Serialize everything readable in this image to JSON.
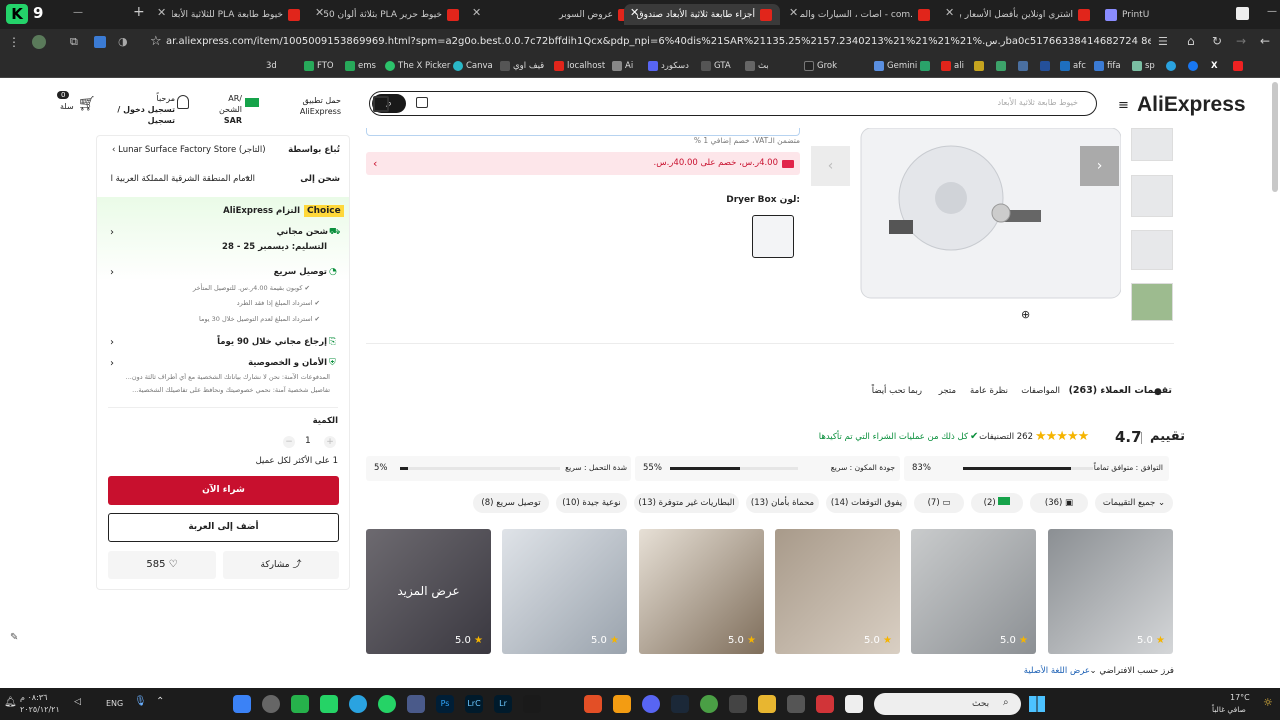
{
  "browser": {
    "tabs": [
      {
        "title": "PrintU"
      },
      {
        "title": "اشتري اونلاين بأفضل الأسعار بال..."
      },
      {
        "title": ".com - اصات ، السيارات والمزيد..."
      },
      {
        "title": "أجزاء طابعة ثلاثية الأبعاد صندوق"
      },
      {
        "title": "عروض السوبر"
      },
      {
        "title": "خيوط حرير PLA بثلاثة ألوان 250"
      },
      {
        "title": "خيوط طابعة PLA للثلاثية الأبعاد 5"
      }
    ],
    "url": "ar.aliexpress.com/item/1005009153869969.html?spm=a2g0o.best.0.0.7c72bffdih1Qcx&pdp_npi=6%40dis%21SAR%21135.25%2157.2340213%21%21%21%21%.ر.سba0c51766338414682724 8eb775%21120000481179654 45%21btfaff...",
    "bookmarks": [
      "sp",
      "fifa",
      "afc",
      "ali",
      "Gemini",
      "Grok",
      "بث",
      "GTA",
      "دسكورد",
      "Ai",
      "localhost",
      "قيف اوي",
      "Canva",
      "The X Picker",
      "ems",
      "FTO",
      "3d"
    ]
  },
  "header": {
    "logo": "AliExpress",
    "search_placeholder": "خيوط طابعة ثلاثية الأبعاد",
    "app_label": "حمل تطبيق",
    "app_label2": "AliExpress",
    "region": "AR/الشحن",
    "currency": "SAR",
    "greeting": "مرحباً",
    "signin": "تسجيل دخول / تسجيل",
    "cart_count": "0",
    "cart_label": "سلة"
  },
  "product": {
    "vat_note": "متضمن الـVAT، خصم إضافي 1 %",
    "coupon": "4.00ر.س، خصم على 40.00ر.س.",
    "color_label": "لون:",
    "color_value": "Dryer Box"
  },
  "tabs": [
    "تقييمات العملاء (263)",
    "المواصفات",
    "نظرة عامة",
    "متجر",
    "ربما تحب أيضاً"
  ],
  "reviews": {
    "title": "تقييم",
    "rating": "4.7",
    "count_text": "262 التصنيفات",
    "verified": "كل ذلك من عمليات الشراء التي تم تأكيدها",
    "metrics": [
      {
        "label": "التوافق : متوافق تماماً",
        "value": "83%",
        "fill": 0.83
      },
      {
        "label": "جودة المكون : سريع",
        "value": "55%",
        "fill": 0.55
      },
      {
        "label": "شدة التحمل : سريع",
        "value": "5%",
        "fill": 0.05
      }
    ],
    "filters": [
      "جميع التقييمات",
      "(36)",
      "(2)",
      "(7)",
      "يفوق التوقعات (14)",
      "محماة بأمان (13)",
      "البطاريات غير متوفرة (13)",
      "نوعية جيدة (10)",
      "توصيل سريع (8)"
    ],
    "images": [
      {
        "rating": "5.0"
      },
      {
        "rating": "5.0"
      },
      {
        "rating": "5.0"
      },
      {
        "rating": "5.0"
      },
      {
        "rating": "5.0"
      },
      {
        "rating": "5.0"
      }
    ],
    "more_label": "عرض المزيد",
    "sort": "فرز حسب الافتراضي",
    "lang": "عرض اللغة الأصلية"
  },
  "side": {
    "sold_by": "تُباع بواسطة",
    "store": "Lunar Surface Factory Store (التاجر)",
    "ship_to": "شحن إلى",
    "location": "الدمام المنطقة الشرقية المملكة العربية الس...",
    "choice": "Choice",
    "commitment": "التزام AliExpress",
    "free_ship": "شحن مجاني",
    "delivery": "التسليم: ديسمبر 25 - 28",
    "fast": "توصيل سريع",
    "fast_items": [
      "كوبون بقيمة 4.00ر.س. للتوصيل المتأخر",
      "استرداد المبلغ إذا فقد الطرد",
      "استرداد المبلغ لعدم التوصيل خلال 30 يوما"
    ],
    "returns": "إرجاع مجاني خلال 90 يوماً",
    "security": "الأمان و الخصوصية",
    "security_text1": "المدفوعات الآمنة: نحن لا نشارك بياناتك الشخصية مع أي أطراف ثالثة دون...",
    "security_text2": "تفاصيل شخصية آمنة: نحمي خصوصيتك ونحافظ على تفاصيلك الشخصية...",
    "qty_label": "الكمية",
    "qty": "1",
    "limit": "1 على الأكثر لكل عميل",
    "buy": "شراء الآن",
    "cart": "أضف إلى العربة",
    "share": "مشاركة",
    "likes": "585"
  },
  "taskbar": {
    "search": "بحث",
    "lang": "ENG",
    "time": "٠٨:٣٦ م",
    "date": "٢٠٢٥/١٢/٢١",
    "temp": "17°C",
    "weather": "صافي غالباً"
  }
}
